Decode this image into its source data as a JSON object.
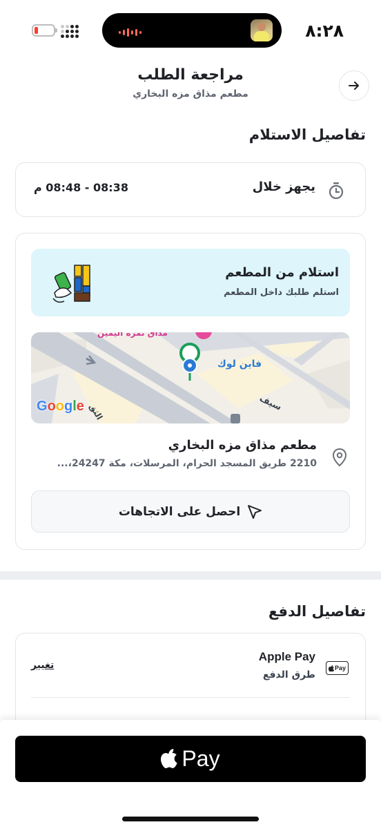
{
  "status_bar": {
    "time": "٨:٢٨",
    "battery_level": 0.15
  },
  "header": {
    "title": "مراجعة الطلب",
    "subtitle": "مطعم مذاق مزه البخاري",
    "back_icon": "arrow-right-icon"
  },
  "pickup": {
    "section_title": "تفاصيل الاستلام",
    "ready_label": "يجهز خلال",
    "ready_time": "08:38 - 08:48 م",
    "banner_title": "استلام من المطعم",
    "banner_subtitle": "استلم طلبك داخل المطعم",
    "map": {
      "label_place": "فاين لوك",
      "label_top": "مذاق تمرة اليمين",
      "label_street": "سيف",
      "label_street2": "الثق",
      "google": "Google",
      "colors": {
        "marker_green": "#1a9e5a",
        "marker_blue": "#2b7bd6",
        "pink": "#e64a9b"
      }
    },
    "restaurant_name": "مطعم مذاق مزه البخاري",
    "restaurant_address": "2210 طريق المسجد الحرام، المرسلات، مكة 24247،...",
    "directions_label": "احصل على الاتجاهات"
  },
  "payment": {
    "section_title": "تفاصيل الدفع",
    "badge": "Pay",
    "method_name": "Apple Pay",
    "method_label": "طرق الدفع",
    "change_label": "تغيير"
  },
  "footer": {
    "pay_button_text": "Pay"
  }
}
